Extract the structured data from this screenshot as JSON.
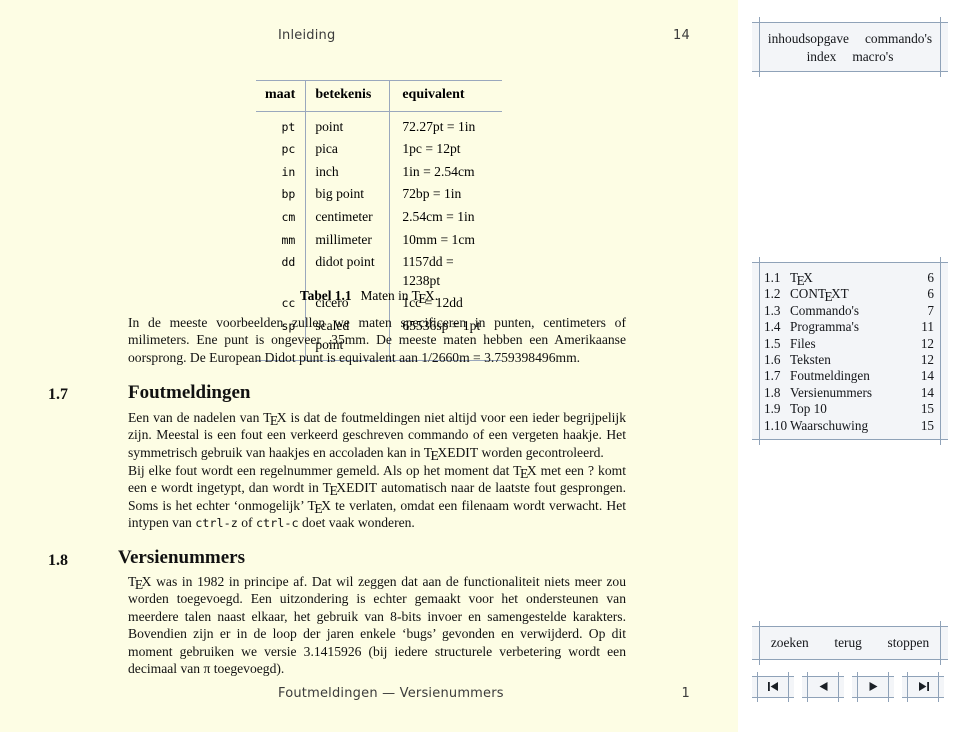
{
  "page": {
    "running_head_title": "Inleiding",
    "running_head_page": "14",
    "running_foot_title": "Foutmeldingen — Versienummers",
    "running_foot_page": "1",
    "background_color": "#fdfde4"
  },
  "table": {
    "headers": [
      "maat",
      "betekenis",
      "equivalent"
    ],
    "rows": [
      {
        "maat": "pt",
        "betekenis": "point",
        "equivalent": "72.27pt = 1in"
      },
      {
        "maat": "pc",
        "betekenis": "pica",
        "equivalent": "1pc = 12pt"
      },
      {
        "maat": "in",
        "betekenis": "inch",
        "equivalent": "1in = 2.54cm"
      },
      {
        "maat": "bp",
        "betekenis": "big point",
        "equivalent": "72bp = 1in"
      },
      {
        "maat": "cm",
        "betekenis": "centimeter",
        "equivalent": "2.54cm = 1in"
      },
      {
        "maat": "mm",
        "betekenis": "millimeter",
        "equivalent": "10mm = 1cm"
      },
      {
        "maat": "dd",
        "betekenis": "didot point",
        "equivalent": "1157dd = 1238pt"
      },
      {
        "maat": "cc",
        "betekenis": "cicero",
        "equivalent": "1cc = 12dd"
      },
      {
        "maat": "sp",
        "betekenis": "scaled point",
        "equivalent": "65536sp = 1pt"
      }
    ],
    "caption_label": "Tabel 1.1",
    "caption_text_before": "Maten in ",
    "caption_text_after": "."
  },
  "body": {
    "intro_paragraph": "In de meeste voorbeelden zullen we maten specificeren in punten, centimeters of milimeters. Ene punt is ongeveer .35mm. De meeste maten hebben een Amerikaanse oorsprong. De European Didot punt is equivalent aan 1/2660m = 3.759398496mm.",
    "sections": [
      {
        "number": "1.7",
        "title": "Foutmeldingen",
        "paragraph1_a": "Een van de nadelen van ",
        "paragraph1_b": " is dat de foutmeldingen niet altijd voor een ieder begrijpelijk zijn. Meestal is een fout een verkeerd geschreven commando of een vergeten haakje. Het symmetrisch gebruik van haakjes en accoladen kan in ",
        "paragraph1_c": "EDIT",
        "paragraph1_d": " worden gecontroleerd.",
        "paragraph2_a": "Bij elke fout wordt een regelnummer gemeld. Als op het moment dat ",
        "paragraph2_b": " met een ? komt een e wordt ingetypt, dan wordt in ",
        "paragraph2_c": "EDIT",
        "paragraph2_d": " automatisch naar de laatste fout gesprongen. Soms is het echter ‘onmogelijk’ ",
        "paragraph2_e": " te verlaten, omdat een filenaam wordt verwacht. Het intypen van ",
        "paragraph2_cmd1": "ctrl-z",
        "paragraph2_f": " of ",
        "paragraph2_cmd2": "ctrl-c",
        "paragraph2_g": " doet vaak wonderen."
      },
      {
        "number": "1.8",
        "title": "Versienummers",
        "paragraph1_a": "",
        "paragraph1_b": " was in 1982 in principe af. Dat wil zeggen dat aan de functionaliteit niets meer zou worden toegevoegd. Een uitzondering is echter gemaakt voor het ondersteunen van meerdere talen naast elkaar, het gebruik van 8-bits invoer en samengestelde karakters. Bovendien zijn er in de loop der jaren enkele ‘bugs’ gevonden en verwijderd. Op dit moment gebruiken we versie 3.1415926 (bij iedere structurele verbetering wordt een decimaal van π toegevoegd)."
      }
    ]
  },
  "panel": {
    "menu_rows": [
      [
        "inhoudsopgave",
        "commando's"
      ],
      [
        "index",
        "macro's"
      ]
    ],
    "toc": [
      {
        "number": "1.1",
        "label": "T E X",
        "tex": true,
        "page": "6"
      },
      {
        "number": "1.2",
        "label": "CONT E XT",
        "tex": true,
        "page": "6"
      },
      {
        "number": "1.3",
        "label": "Commando's",
        "tex": false,
        "page": "7"
      },
      {
        "number": "1.4",
        "label": "Programma's",
        "tex": false,
        "page": "11"
      },
      {
        "number": "1.5",
        "label": "Files",
        "tex": false,
        "page": "12"
      },
      {
        "number": "1.6",
        "label": "Teksten",
        "tex": false,
        "page": "12"
      },
      {
        "number": "1.7",
        "label": "Foutmeldingen",
        "tex": false,
        "page": "14"
      },
      {
        "number": "1.8",
        "label": "Versienummers",
        "tex": false,
        "page": "14"
      },
      {
        "number": "1.9",
        "label": "Top 10",
        "tex": false,
        "page": "15"
      },
      {
        "number": "1.10",
        "label": "Waarschuwing",
        "tex": false,
        "page": "15"
      }
    ],
    "actions": [
      "zoeken",
      "terug",
      "stoppen"
    ],
    "nav_buttons": [
      {
        "name": "first-page",
        "glyph": "skip-back-icon"
      },
      {
        "name": "previous-page",
        "glyph": "triangle-left-icon"
      },
      {
        "name": "next-page",
        "glyph": "triangle-right-icon"
      },
      {
        "name": "last-page",
        "glyph": "skip-forward-icon"
      }
    ],
    "box_border_color": "#8fa2b8",
    "box_fill_color": "#f3f5f8"
  }
}
